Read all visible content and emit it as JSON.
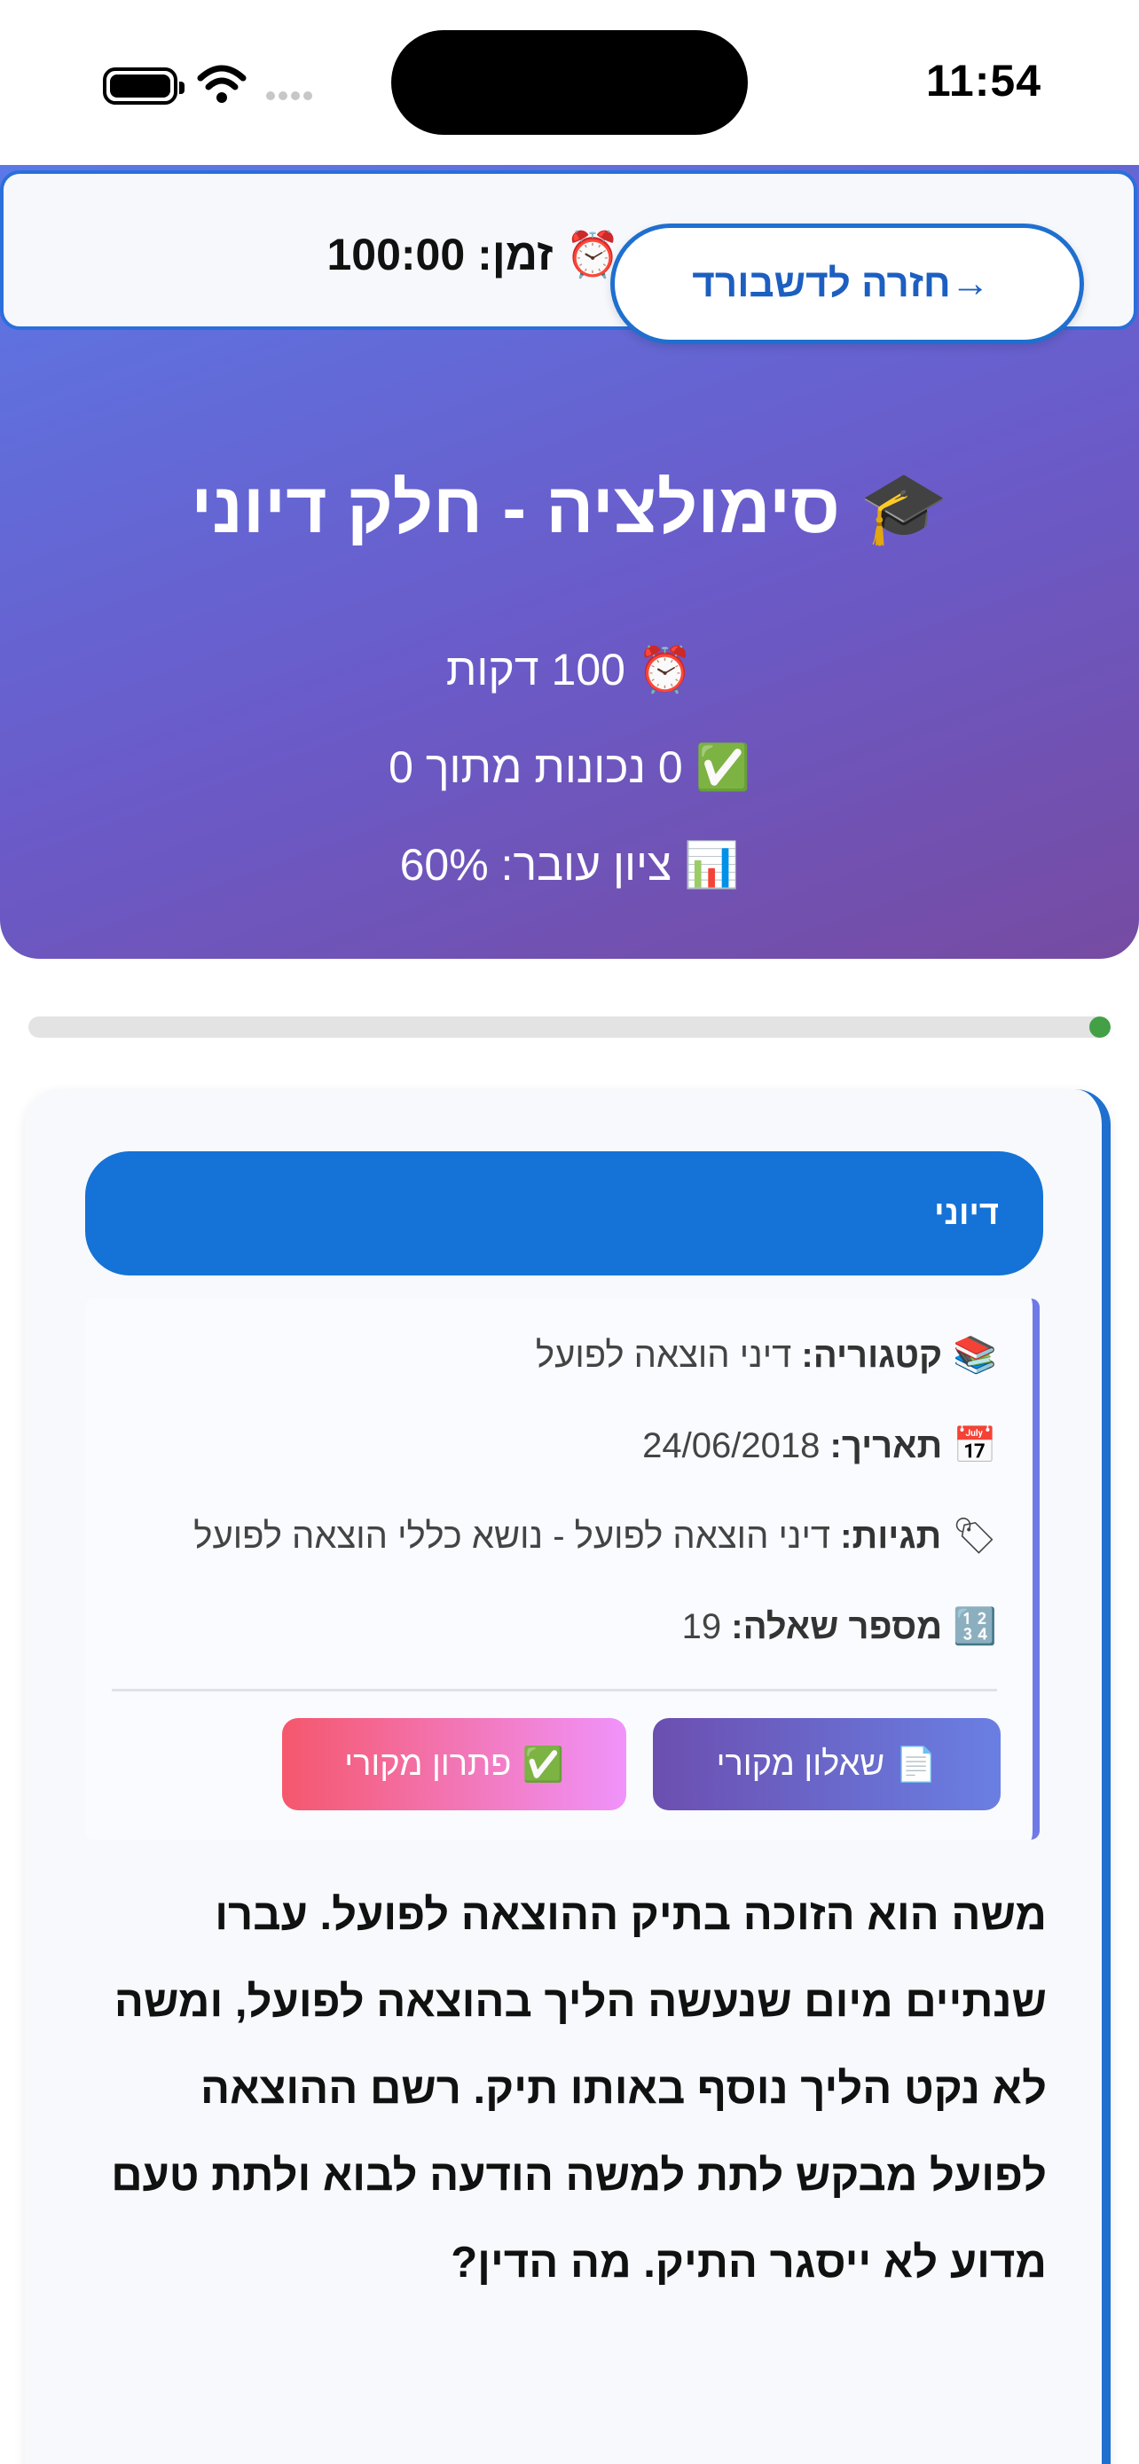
{
  "status_bar": {
    "time": "11:54"
  },
  "timer": {
    "label": "⏰ זמן: 100:00"
  },
  "back_button": {
    "label": "חזרה לדשבורד",
    "arrow": "→"
  },
  "hero": {
    "title": "🎓 סימולציה - חלק דיוני",
    "duration": "⏰ 100 דקות",
    "correct": "✅ 0 נכונות מתוך 0",
    "pass_score": "📊 ציון עובר: 60%"
  },
  "progress": {
    "value_percent": 2,
    "color": "#43a047"
  },
  "card": {
    "tag": "דיוני",
    "meta": {
      "category_label": "קטגוריה:",
      "category_value": "דיני הוצאה לפועל",
      "date_label": "תאריך:",
      "date_value": "24/06/2018",
      "tags_label": "תגיות:",
      "tags_value": "דיני הוצאה לפועל - נושא כללי הוצאה לפועל",
      "number_label": "מספר שאלה:",
      "number_value": "19"
    },
    "buttons": {
      "original_questionnaire": "שאלון מקורי",
      "original_solution": "פתרון מקורי"
    },
    "question_text": "משה הוא הזוכה בתיק ההוצאה לפועל. עברו שנתיים מיום שנעשה הליך בהוצאה לפועל, ומשה לא נקט הליך נוסף באותו תיק. רשם ההוצאה לפועל מבקש לתת למשה הודעה לבוא ולתת טעם מדוע לא ייסגר התיק. מה הדין?"
  },
  "icons": {
    "battery": "battery-icon",
    "wifi": "wifi-icon",
    "category": "books-icon",
    "date": "calendar-icon",
    "tags": "label-icon",
    "number": "numbers-icon",
    "questionnaire": "document-icon",
    "solution": "check-icon"
  }
}
